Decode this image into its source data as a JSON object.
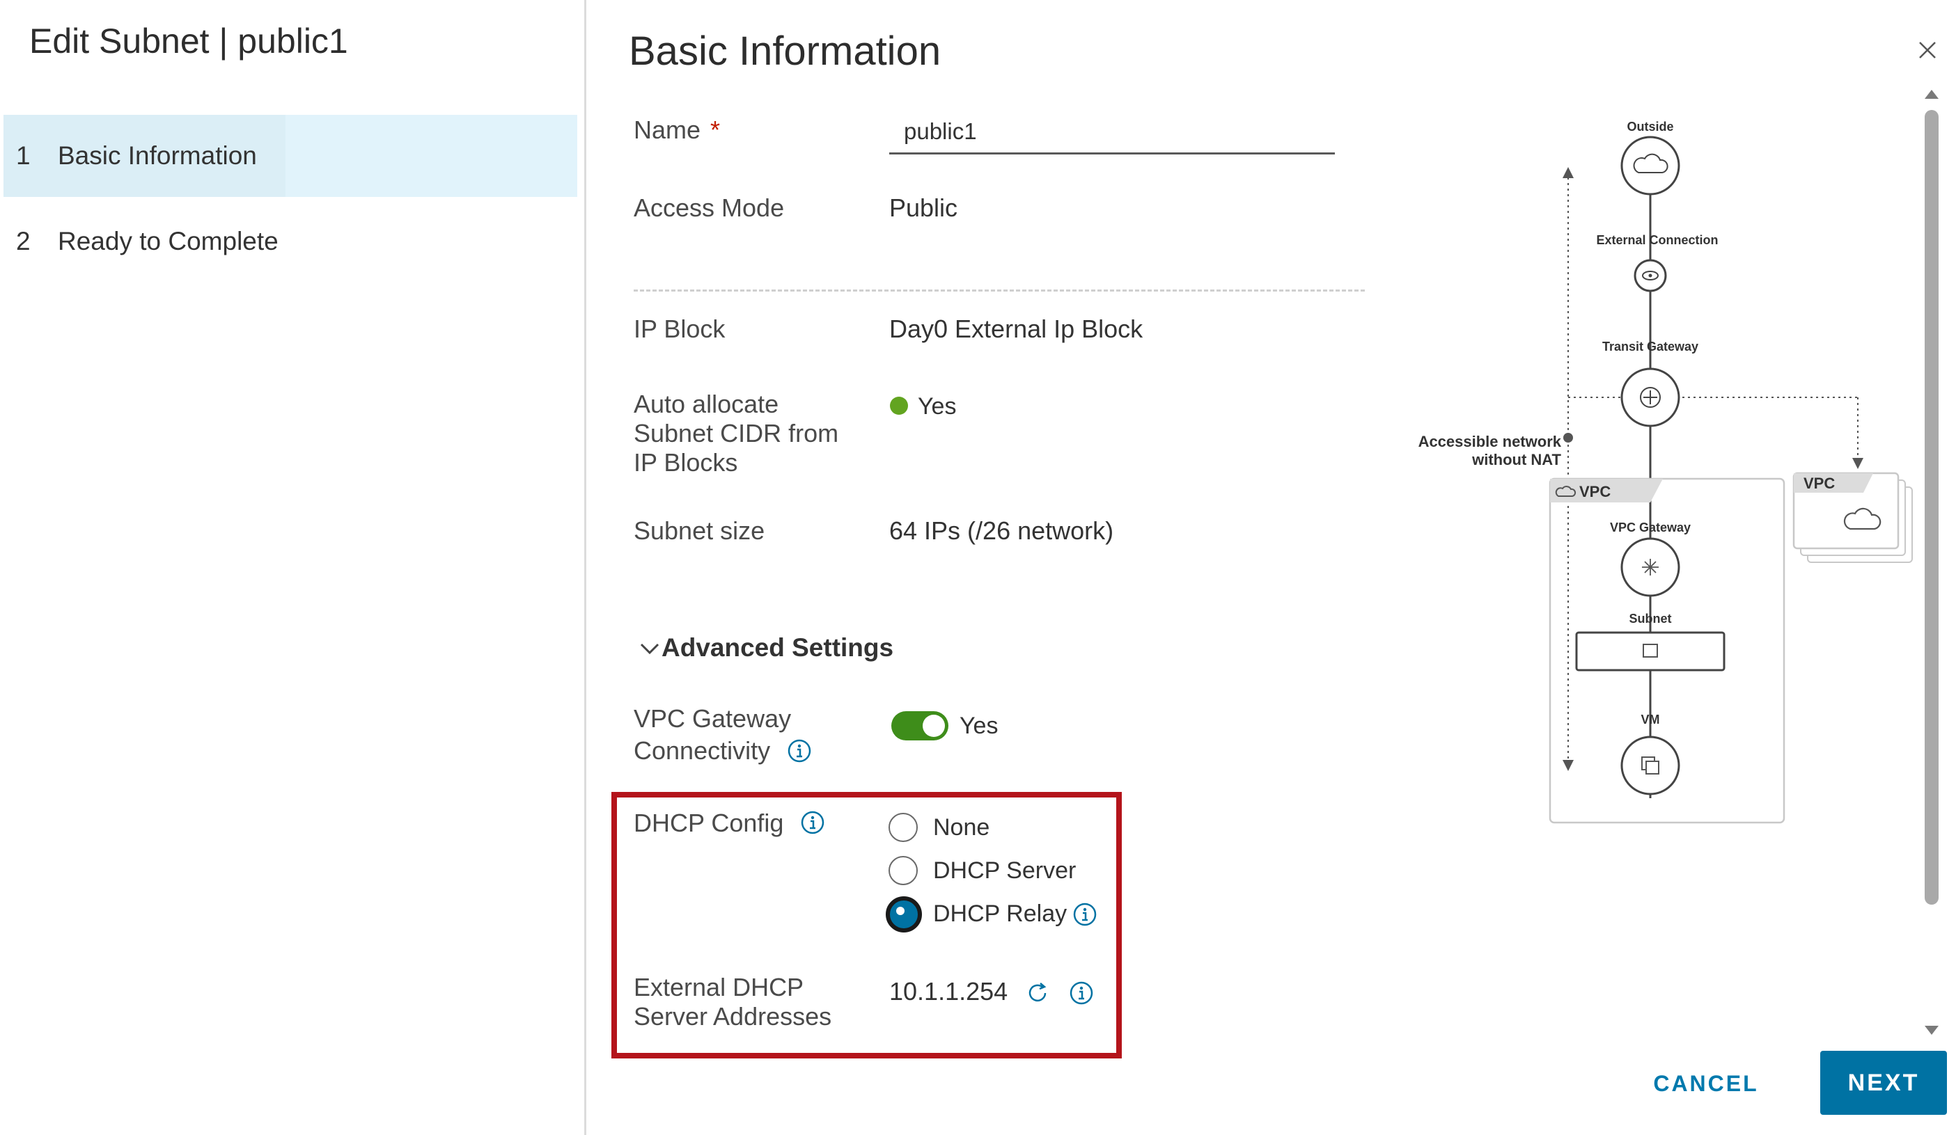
{
  "wizard": {
    "title": "Edit Subnet | public1",
    "steps": [
      {
        "number": "1",
        "label": "Basic Information",
        "active": true
      },
      {
        "number": "2",
        "label": "Ready to Complete",
        "active": false
      }
    ]
  },
  "form": {
    "title": "Basic Information",
    "name": {
      "label": "Name",
      "required_marker": "*",
      "value": "public1"
    },
    "access_mode": {
      "label": "Access Mode",
      "value": "Public"
    },
    "ip_block": {
      "label": "IP Block",
      "value": "Day0 External Ip Block"
    },
    "auto_allocate": {
      "label_lines": [
        "Auto allocate",
        "Subnet CIDR from",
        "IP Blocks"
      ],
      "value": "Yes",
      "status_color": "#62a420"
    },
    "subnet_size": {
      "label": "Subnet size",
      "value": "64 IPs (/26 network)"
    },
    "advanced": {
      "header": "Advanced Settings",
      "vpc_gateway": {
        "label_lines": [
          "VPC Gateway",
          "Connectivity"
        ],
        "value": "Yes",
        "enabled": true,
        "toggle_color": "#3e8d1a"
      },
      "dhcp_config": {
        "label": "DHCP Config",
        "options": [
          "None",
          "DHCP Server",
          "DHCP Relay"
        ],
        "selected": "DHCP Relay"
      },
      "external_dhcp": {
        "label_lines": [
          "External DHCP",
          "Server Addresses"
        ],
        "value": "10.1.1.254"
      }
    }
  },
  "diagram": {
    "nodes": {
      "outside": "Outside",
      "external_connection": "External Connection",
      "transit_gateway": "Transit Gateway",
      "vpc_gateway": "VPC Gateway",
      "subnet": "Subnet",
      "vm": "VM"
    },
    "accessible_network": [
      "Accessible network",
      "without NAT"
    ],
    "vpc_label": "VPC",
    "vpc_label_2": "VPC"
  },
  "footer": {
    "cancel_label": "CANCEL",
    "next_label": "NEXT"
  },
  "colors": {
    "accent": "#0072a3",
    "highlight": "#b4141b",
    "selected_step_bg": "#e1f3fb"
  },
  "icons": [
    "close-icon",
    "chevron-down-icon",
    "info-icon",
    "refresh-icon",
    "cloud-icon",
    "eye-icon",
    "gateway-icon",
    "subnet-icon",
    "vm-icon"
  ]
}
